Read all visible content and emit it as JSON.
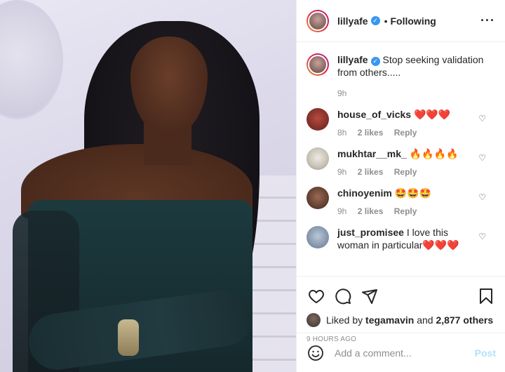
{
  "post": {
    "username": "lillyafe",
    "follow_status": "Following",
    "separator": "•",
    "more_icon": "more-horizontal-icon"
  },
  "caption": {
    "username": "lillyafe",
    "text": "Stop seeking validation from others.....",
    "time": "9h"
  },
  "comments": [
    {
      "username": "house_of_vicks",
      "text": "❤️❤️❤️",
      "time": "8h",
      "likes": "2 likes",
      "reply": "Reply"
    },
    {
      "username": "mukhtar__mk_",
      "text": "🔥🔥🔥🔥",
      "time": "9h",
      "likes": "2 likes",
      "reply": "Reply"
    },
    {
      "username": "chinoyenim",
      "text": "🤩🤩🤩",
      "time": "9h",
      "likes": "2 likes",
      "reply": "Reply"
    },
    {
      "username": "just_promisee",
      "text": "I love this woman in particular❤️❤️❤️",
      "time": "",
      "likes": "",
      "reply": ""
    }
  ],
  "actions": {
    "liked_by_prefix": "Liked by",
    "liked_by_user": "tegamavin",
    "liked_by_and": "and",
    "others_count": "2,877 others",
    "time_ago": "9 HOURS AGO"
  },
  "add_comment": {
    "placeholder": "Add a comment...",
    "post_label": "Post"
  },
  "colors": {
    "verified": "#3897f0",
    "post_button_disabled": "#b2dffc",
    "muted_text": "#8e8e8e",
    "text": "#262626"
  }
}
